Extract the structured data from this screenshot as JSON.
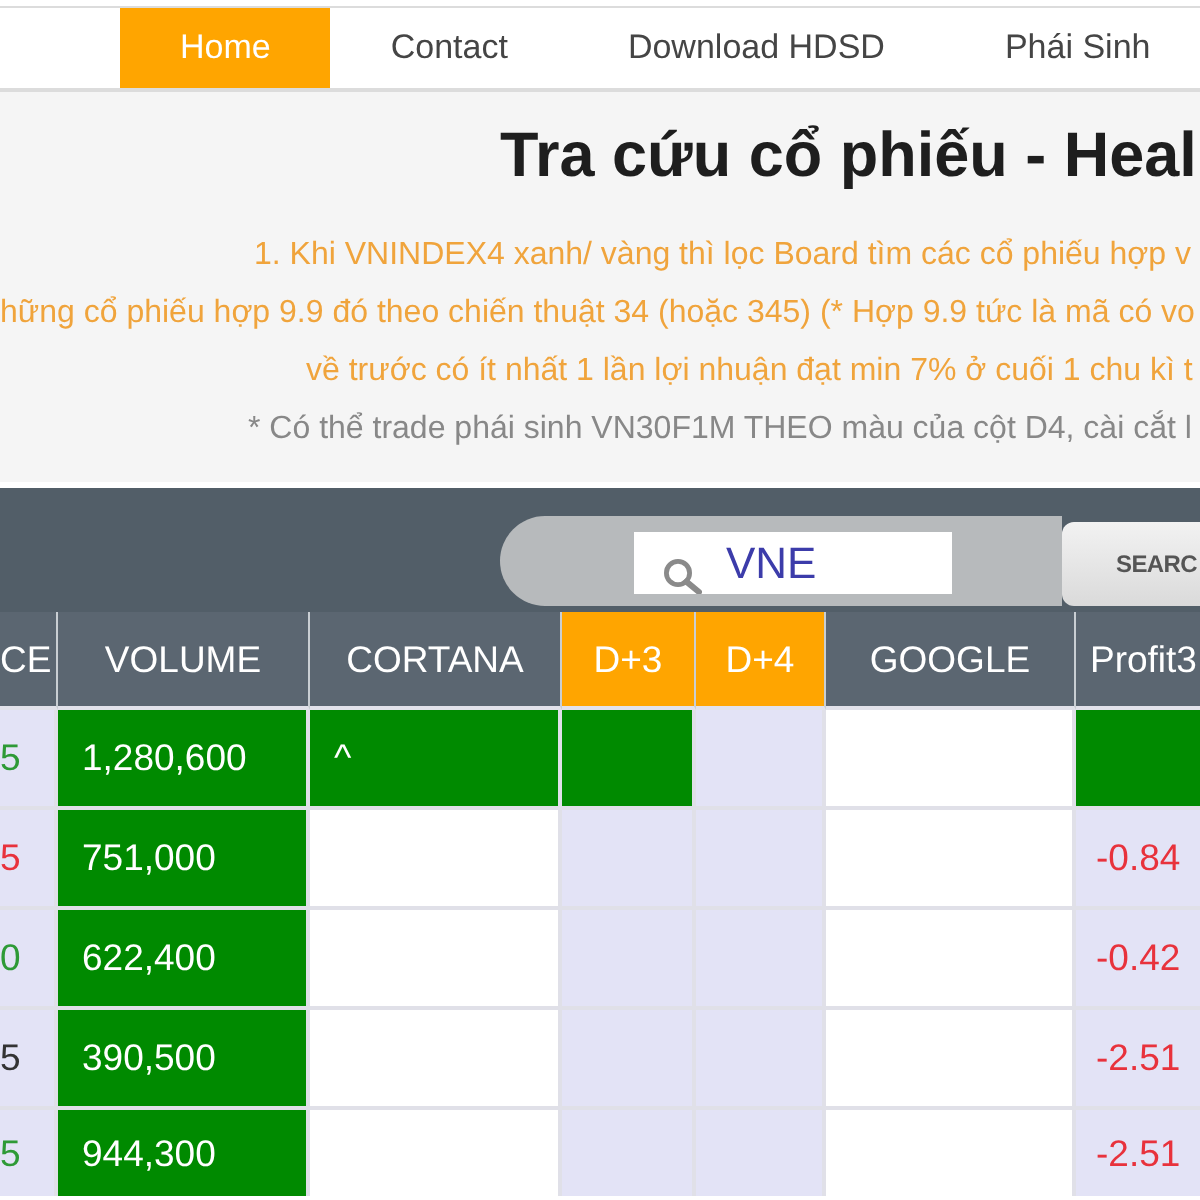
{
  "nav": {
    "items": [
      {
        "label": "Home",
        "selected": true
      },
      {
        "label": "Contact",
        "selected": false
      },
      {
        "label": "Download HDSD",
        "selected": false
      },
      {
        "label": "Phái Sinh",
        "selected": false
      }
    ]
  },
  "page": {
    "title": "Tra cứu cổ phiếu - Heal",
    "notes": [
      {
        "kind": "highlight",
        "text": "1. Khi VNINDEX4 xanh/ vàng thì lọc Board tìm các cổ phiếu hợp v"
      },
      {
        "kind": "highlight",
        "text": "hững cổ phiếu hợp 9.9 đó theo chiến thuật 34 (hoặc 345) (* Hợp 9.9 tức là mã có vo"
      },
      {
        "kind": "highlight",
        "text": "về trước có ít nhất 1 lần lợi nhuận đạt min 7% ở cuối 1 chu kì t"
      },
      {
        "kind": "plain",
        "text": "* Có thể trade phái sinh VN30F1M THEO màu của cột D4, cài cắt l"
      }
    ]
  },
  "search": {
    "value": "VNE",
    "button": "SEARC"
  },
  "table": {
    "columns": [
      {
        "label": "CE",
        "highlighted": false
      },
      {
        "label": "VOLUME",
        "highlighted": false
      },
      {
        "label": "CORTANA",
        "highlighted": false
      },
      {
        "label": "D+3",
        "highlighted": true
      },
      {
        "label": "D+4",
        "highlighted": true
      },
      {
        "label": "GOOGLE",
        "highlighted": false
      },
      {
        "label": "Profit3",
        "highlighted": false
      }
    ],
    "rows": [
      {
        "cells": [
          {
            "kind": "shaded",
            "text": "5",
            "color": "#2e9a36"
          },
          {
            "kind": "signal",
            "text": "1,280,600"
          },
          {
            "kind": "signal",
            "text": "^"
          },
          {
            "kind": "signal"
          },
          {
            "kind": "shaded"
          },
          {
            "kind": "plain"
          },
          {
            "kind": "signal"
          }
        ]
      },
      {
        "cells": [
          {
            "kind": "shaded",
            "text": "5",
            "color": "#e8323c"
          },
          {
            "kind": "signal",
            "text": "751,000"
          },
          {
            "kind": "plain"
          },
          {
            "kind": "shaded"
          },
          {
            "kind": "shaded"
          },
          {
            "kind": "plain"
          },
          {
            "kind": "shaded",
            "text": "-0.84",
            "color": "#e8323c"
          }
        ]
      },
      {
        "cells": [
          {
            "kind": "shaded",
            "text": "0",
            "color": "#2e9a36"
          },
          {
            "kind": "signal",
            "text": "622,400"
          },
          {
            "kind": "plain"
          },
          {
            "kind": "shaded"
          },
          {
            "kind": "shaded"
          },
          {
            "kind": "plain"
          },
          {
            "kind": "shaded",
            "text": "-0.42",
            "color": "#e8323c"
          }
        ]
      },
      {
        "cells": [
          {
            "kind": "shaded",
            "text": "5",
            "color": "#333333"
          },
          {
            "kind": "signal",
            "text": "390,500"
          },
          {
            "kind": "plain"
          },
          {
            "kind": "shaded"
          },
          {
            "kind": "shaded"
          },
          {
            "kind": "plain"
          },
          {
            "kind": "shaded",
            "text": "-2.51",
            "color": "#e8323c"
          }
        ]
      },
      {
        "cells": [
          {
            "kind": "shaded",
            "text": "5",
            "color": "#2e9a36"
          },
          {
            "kind": "signal",
            "text": "944,300"
          },
          {
            "kind": "plain"
          },
          {
            "kind": "shaded"
          },
          {
            "kind": "shaded"
          },
          {
            "kind": "plain"
          },
          {
            "kind": "shaded",
            "text": "-2.51",
            "color": "#e8323c"
          }
        ]
      }
    ]
  }
}
